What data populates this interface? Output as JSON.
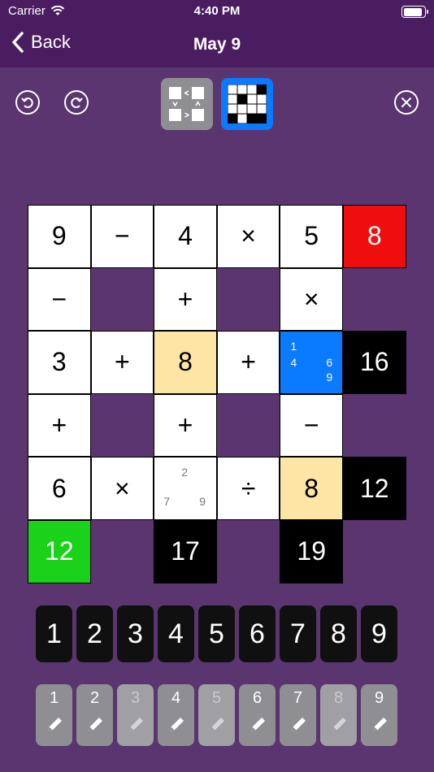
{
  "status": {
    "carrier": "Carrier",
    "time": "4:40 PM"
  },
  "nav": {
    "back_label": "Back",
    "title": "May 9"
  },
  "grid": {
    "r0": [
      "9",
      "−",
      "4",
      "×",
      "5",
      "8"
    ],
    "r1": [
      "−",
      "+",
      "×"
    ],
    "r2": [
      "3",
      "+",
      "8",
      "+",
      "16"
    ],
    "r2_notes": [
      "1",
      "4",
      "6",
      "9"
    ],
    "r3": [
      "+",
      "+",
      "−"
    ],
    "r4": [
      "6",
      "×",
      "÷",
      "8",
      "12"
    ],
    "r4_notes": [
      "2",
      "7",
      "9"
    ],
    "r5": [
      "12",
      "17",
      "19"
    ]
  },
  "numpad": [
    "1",
    "2",
    "3",
    "4",
    "5",
    "6",
    "7",
    "8",
    "9"
  ],
  "pencilpad": [
    "1",
    "2",
    "3",
    "4",
    "5",
    "6",
    "7",
    "8",
    "9"
  ],
  "colors": {
    "header": "#4a1d60",
    "background": "#5a3570",
    "selected": "#0a7aff",
    "wrong": "#f00d0d",
    "correct": "#1bd21b",
    "highlight": "#fde5a6"
  }
}
